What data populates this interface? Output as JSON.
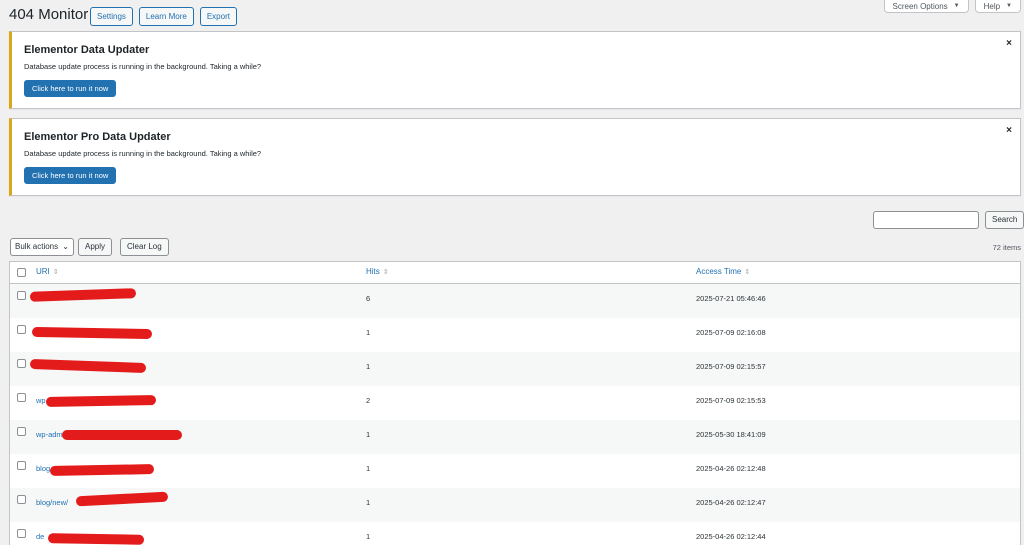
{
  "page": {
    "title": "404 Monitor",
    "buttons": {
      "settings": "Settings",
      "learn_more": "Learn More",
      "export": "Export"
    }
  },
  "screen_tabs": {
    "screen_options": "Screen Options",
    "help": "Help"
  },
  "notices": [
    {
      "title": "Elementor Data Updater",
      "message": "Database update process is running in the background. Taking a while?",
      "button": "Click here to run it now",
      "dismiss": "×"
    },
    {
      "title": "Elementor Pro Data Updater",
      "message": "Database update process is running in the background. Taking a while?",
      "button": "Click here to run it now",
      "dismiss": "×"
    }
  ],
  "search": {
    "input_value": "",
    "button": "Search"
  },
  "toolbar": {
    "bulk_actions": "Bulk actions",
    "apply": "Apply",
    "clear_log": "Clear Log",
    "items_count": "72 items"
  },
  "table": {
    "columns": {
      "uri": "URI",
      "hits": "Hits",
      "access_time": "Access Time"
    },
    "rows": [
      {
        "uri": "",
        "hits": "6",
        "access_time": "2025-07-21 05:46:46"
      },
      {
        "uri": "",
        "hits": "1",
        "access_time": "2025-07-09 02:16:08"
      },
      {
        "uri": "",
        "hits": "1",
        "access_time": "2025-07-09 02:15:57"
      },
      {
        "uri": "wp",
        "hits": "2",
        "access_time": "2025-07-09 02:15:53"
      },
      {
        "uri": "wp-adm",
        "hits": "1",
        "access_time": "2025-05-30 18:41:09"
      },
      {
        "uri": "blog",
        "hits": "1",
        "access_time": "2025-04-26 02:12:48"
      },
      {
        "uri": "blog/new/",
        "hits": "1",
        "access_time": "2025-04-26 02:12:47"
      },
      {
        "uri": "de",
        "hits": "1",
        "access_time": "2025-04-26 02:12:44"
      }
    ]
  },
  "colors": {
    "accent": "#2271b1",
    "notice_warning": "#dba617",
    "redaction": "#e31b1b"
  },
  "icons": {
    "sort": "sort-arrows-icon",
    "dismiss": "close-icon",
    "dropdown": "chevron-down-icon"
  }
}
